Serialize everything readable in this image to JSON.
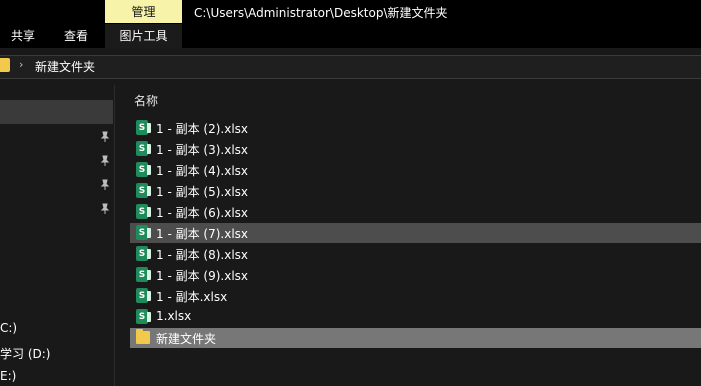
{
  "ribbon": {
    "manage_tab": "管理",
    "title": "C:\\Users\\Administrator\\Desktop\\新建文件夹",
    "tabs": [
      "共享",
      "查看",
      "图片工具"
    ]
  },
  "address": {
    "path": "新建文件夹"
  },
  "nav": {
    "drives": [
      "C:)",
      "学习 (D:)",
      "E:)"
    ]
  },
  "content": {
    "column_header": "名称",
    "files": [
      {
        "name": "1 - 副本 (2).xlsx",
        "type": "excel"
      },
      {
        "name": "1 - 副本 (3).xlsx",
        "type": "excel"
      },
      {
        "name": "1 - 副本 (4).xlsx",
        "type": "excel"
      },
      {
        "name": "1 - 副本 (5).xlsx",
        "type": "excel"
      },
      {
        "name": "1 - 副本 (6).xlsx",
        "type": "excel"
      },
      {
        "name": "1 - 副本 (7).xlsx",
        "type": "excel"
      },
      {
        "name": "1 - 副本 (8).xlsx",
        "type": "excel"
      },
      {
        "name": "1 - 副本 (9).xlsx",
        "type": "excel"
      },
      {
        "name": "1 - 副本.xlsx",
        "type": "excel"
      },
      {
        "name": "1.xlsx",
        "type": "excel"
      },
      {
        "name": "新建文件夹",
        "type": "folder"
      }
    ]
  },
  "colors": {
    "manage_tab_bg": "#f7f3a9",
    "excel_icon": "#1f8a5a",
    "folder_icon": "#f2c94c"
  }
}
